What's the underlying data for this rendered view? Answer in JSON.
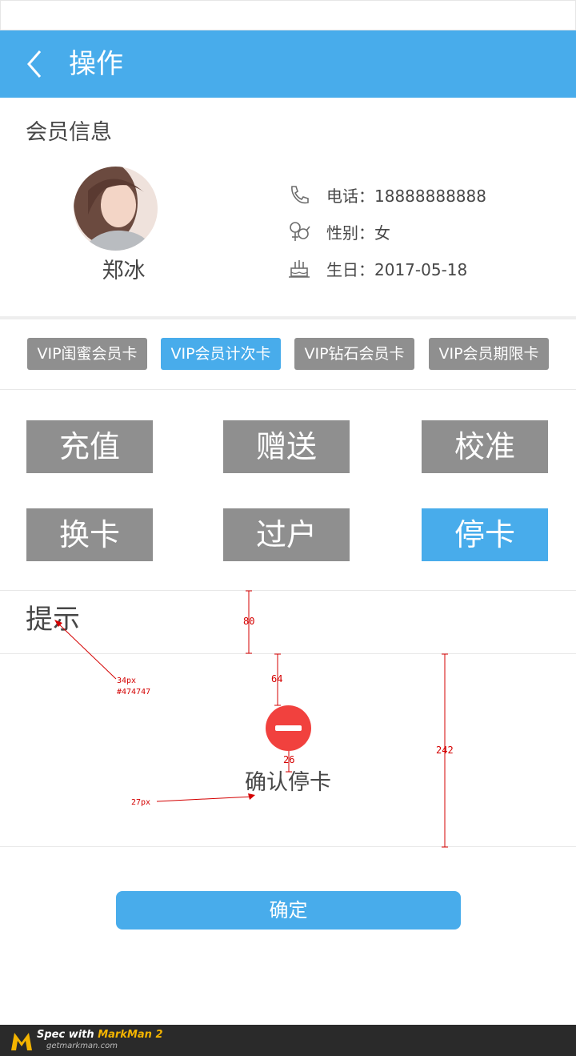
{
  "header": {
    "title": "操作"
  },
  "member": {
    "section_title": "会员信息",
    "name": "郑冰",
    "phone": "电话：18888888888",
    "gender": "性别：女",
    "birthday": "生日：2017-05-18"
  },
  "card_tabs": [
    {
      "label": "VIP闺蜜会员卡",
      "active": false
    },
    {
      "label": "VIP会员计次卡",
      "active": true
    },
    {
      "label": "VIP钻石会员卡",
      "active": false
    },
    {
      "label": "VIP会员期限卡",
      "active": false
    }
  ],
  "operations": [
    {
      "label": "充值",
      "active": false
    },
    {
      "label": "赠送",
      "active": false
    },
    {
      "label": "校准",
      "active": false
    },
    {
      "label": "换卡",
      "active": false
    },
    {
      "label": "过户",
      "active": false
    },
    {
      "label": "停卡",
      "active": true
    }
  ],
  "tip": {
    "title": "提示",
    "message": "确认停卡",
    "confirm_button": "确定"
  },
  "annotations": {
    "gap_title": "80",
    "gap_icon_top": "64",
    "gap_icon_text": "26",
    "tip_height": "242",
    "title_font_size": "34px",
    "title_color": "#474747",
    "message_font_size": "27px"
  },
  "colors": {
    "primary": "#48aceb",
    "button_gray": "#8f8f8f",
    "text": "#474747",
    "stop_red": "#f1413e",
    "spec_red": "#d40000"
  },
  "footer": {
    "brand_prefix": "Spec with ",
    "brand_name": "MarkMan 2",
    "url": "getmarkman.com"
  }
}
